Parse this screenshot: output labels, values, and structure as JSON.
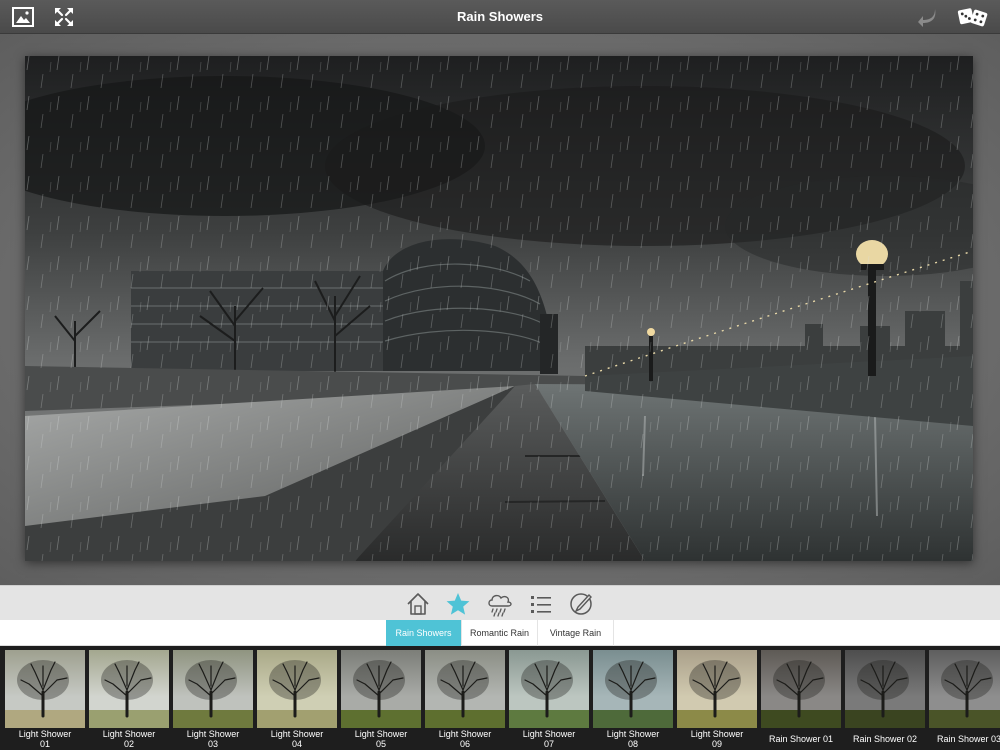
{
  "header": {
    "title": "Rain Showers",
    "left_buttons": [
      {
        "icon": "image-icon"
      },
      {
        "icon": "fullscreen-icon"
      }
    ],
    "right_buttons": [
      {
        "icon": "undo-icon"
      },
      {
        "icon": "dice-icon"
      }
    ]
  },
  "canvas": {
    "description_icon": "photo-canvas"
  },
  "toolbar": {
    "tools": [
      {
        "icon": "home-icon"
      },
      {
        "icon": "star-icon",
        "active": true
      },
      {
        "icon": "rain-cloud-icon"
      },
      {
        "icon": "list-icon"
      },
      {
        "icon": "brush-icon"
      }
    ]
  },
  "tabs": [
    {
      "label": "Rain Showers",
      "active": true
    },
    {
      "label": "Romantic Rain",
      "active": false
    },
    {
      "label": "Vintage Rain",
      "active": false
    }
  ],
  "filters": [
    {
      "line1": "Light Shower",
      "line2": "01"
    },
    {
      "line1": "Light Shower",
      "line2": "02"
    },
    {
      "line1": "Light Shower",
      "line2": "03"
    },
    {
      "line1": "Light Shower",
      "line2": "04"
    },
    {
      "line1": "Light Shower",
      "line2": "05"
    },
    {
      "line1": "Light Shower",
      "line2": "06"
    },
    {
      "line1": "Light Shower",
      "line2": "07"
    },
    {
      "line1": "Light Shower",
      "line2": "08"
    },
    {
      "line1": "Light Shower",
      "line2": "09"
    },
    {
      "line1": "Rain Shower 01",
      "line2": ""
    },
    {
      "line1": "Rain Shower 02",
      "line2": ""
    },
    {
      "line1": "Rain Shower 03",
      "line2": ""
    }
  ],
  "colors": {
    "accent": "#4fc3d6",
    "topbar": "#4f4f4f",
    "strip": "#1e1e1e"
  }
}
